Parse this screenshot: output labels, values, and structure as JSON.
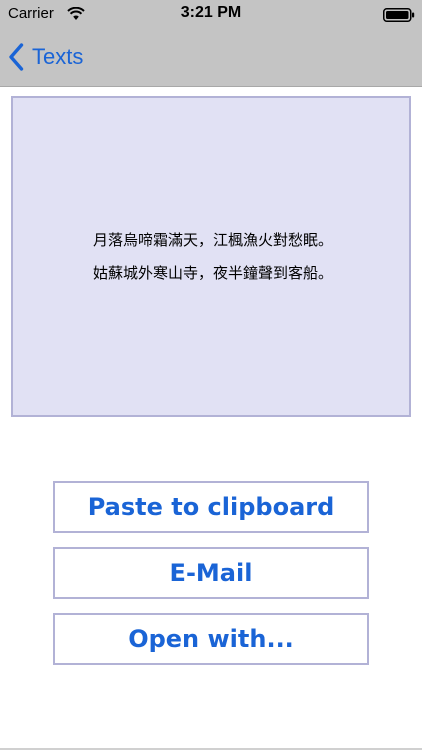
{
  "status_bar": {
    "carrier": "Carrier",
    "time": "3:21 PM",
    "wifi_icon": "wifi-icon",
    "battery_icon": "battery-icon"
  },
  "nav": {
    "back_label": "Texts",
    "back_icon": "chevron-left-icon"
  },
  "poem": {
    "line1": "月落烏啼霜滿天，江楓漁火對愁眠。",
    "line2": "姑蘇城外寒山寺，夜半鐘聲到客船。"
  },
  "actions": {
    "paste_label": "Paste to clipboard",
    "email_label": "E-Mail",
    "open_label": "Open with..."
  },
  "colors": {
    "accent": "#1a64d6",
    "bar_bg": "#c4c4c4",
    "panel_bg": "#e1e1f4",
    "panel_border": "#b2b2d6"
  }
}
